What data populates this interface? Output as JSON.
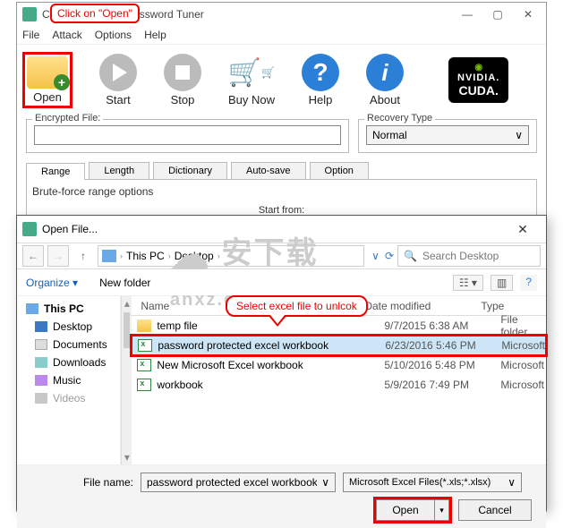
{
  "main": {
    "title": "Cocosenor Excel Password Tuner",
    "menu": [
      "File",
      "Attack",
      "Options",
      "Help"
    ],
    "toolbar": {
      "open": "Open",
      "start": "Start",
      "stop": "Stop",
      "buynow": "Buy Now",
      "help": "Help",
      "about": "About"
    },
    "cuda": {
      "brand": "NVIDIA.",
      "line2": "CUDA."
    },
    "encrypted_label": "Encrypted File:",
    "encrypted_value": "",
    "recovery_label": "Recovery Type",
    "recovery_value": "Normal",
    "tabs": [
      "Range",
      "Length",
      "Dictionary",
      "Auto-save",
      "Option"
    ],
    "tab_body_title": "Brute-force range options",
    "tab_body_sub": "Start from:"
  },
  "callout1": "Click on \"Open\"",
  "dialog": {
    "title": "Open File...",
    "breadcrumb": [
      "This PC",
      "Desktop"
    ],
    "search_placeholder": "Search Desktop",
    "organize": "Organize",
    "newfolder": "New folder",
    "sidebar": [
      {
        "label": "This PC",
        "icon": "pc-i",
        "bold": true
      },
      {
        "label": "Desktop",
        "icon": "dk-i"
      },
      {
        "label": "Documents",
        "icon": "doc-i"
      },
      {
        "label": "Downloads",
        "icon": "dl-i"
      },
      {
        "label": "Music",
        "icon": "mu-i"
      },
      {
        "label": "Videos",
        "icon": "vid-i"
      }
    ],
    "columns": [
      "Name",
      "Date modified",
      "Type"
    ],
    "rows": [
      {
        "icon": "fi-folder",
        "name": "temp file",
        "date": "9/7/2015 6:38 AM",
        "type": "File folder"
      },
      {
        "icon": "fi-xls",
        "name": "password protected excel workbook",
        "date": "6/23/2016 5:46 PM",
        "type": "Microsoft",
        "selected": true
      },
      {
        "icon": "fi-xls",
        "name": "New Microsoft Excel workbook",
        "date": "5/10/2016 5:48 PM",
        "type": "Microsoft"
      },
      {
        "icon": "fi-xls",
        "name": "workbook",
        "date": "5/9/2016 7:49 PM",
        "type": "Microsoft"
      }
    ],
    "filename_label": "File name:",
    "filename_value": "password protected excel workbook",
    "filter_value": "Microsoft Excel Files(*.xls;*.xlsx)",
    "open_btn": "Open",
    "cancel_btn": "Cancel"
  },
  "callout2": "Select excel file to unlcok",
  "watermark": "安下载\nanxz.com"
}
